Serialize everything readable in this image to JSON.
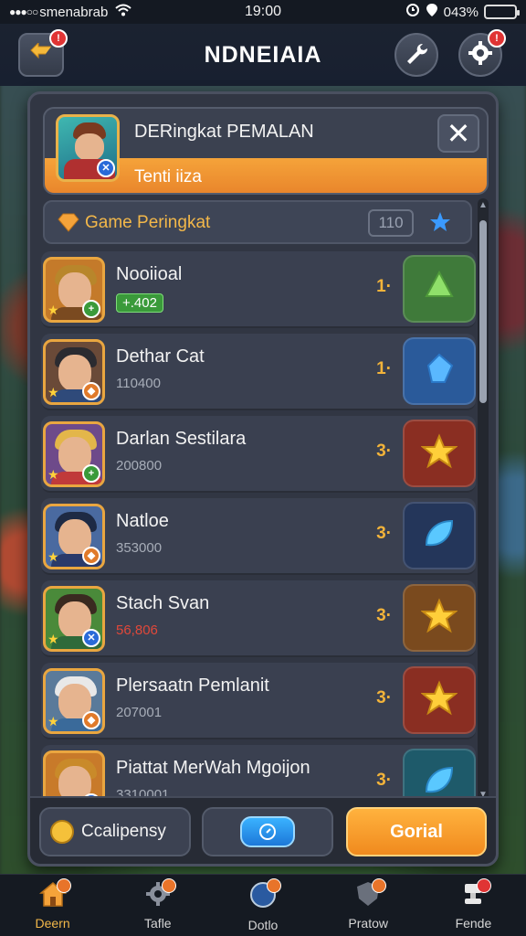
{
  "status_bar": {
    "carrier": "smenabrab",
    "time": "19:00",
    "battery": "043%",
    "battery_level": 0.43
  },
  "top_bar": {
    "title": "NDNEIAIA",
    "back_icon": "back-arrow-icon",
    "wrench_icon": "wrench-icon",
    "settings_icon": "gear-icon"
  },
  "panel": {
    "title": "DERingkat PEMALAN",
    "subtitle": "Tenti iiza",
    "close_label": "✕",
    "tab": {
      "label": "Game Peringkat",
      "count": "110"
    }
  },
  "players": [
    {
      "name": "Nooiioal",
      "score": "+.402",
      "score_style": "pill",
      "rank": "1·",
      "reward_color": "#3f7a3a",
      "reward_icon": "green-gem-icon",
      "hair": "#b8862b",
      "body": "#7a4a20",
      "bg": "#c47a2a",
      "badge": "+",
      "badge_color": "#3a9a3a"
    },
    {
      "name": "Dethar Cat",
      "score": "110400",
      "score_style": "normal",
      "rank": "1·",
      "reward_color": "#2a5a9a",
      "reward_icon": "blue-crystal-icon",
      "hair": "#2b2b30",
      "body": "#2f4a7a",
      "bg": "#6a4a38",
      "badge": "◆",
      "badge_color": "#e07a2a"
    },
    {
      "name": "Darlan Sestilara",
      "score": "200800",
      "score_style": "normal",
      "rank": "3·",
      "reward_color": "#8a2e22",
      "reward_icon": "gold-star-icon",
      "hair": "#e3b64a",
      "body": "#c03a3a",
      "bg": "#6e4a8a",
      "badge": "+",
      "badge_color": "#3a9a3a"
    },
    {
      "name": "Natloe",
      "score": "353000",
      "score_style": "normal",
      "rank": "3·",
      "reward_color": "#24365a",
      "reward_icon": "blue-leaf-icon",
      "hair": "#1e2a44",
      "body": "#2a3a6a",
      "bg": "#4a6aa0",
      "badge": "◆",
      "badge_color": "#e07a2a"
    },
    {
      "name": "Stach Svan",
      "score": "56,806",
      "score_style": "red",
      "rank": "3·",
      "reward_color": "#7a4a1e",
      "reward_icon": "gold-star-icon",
      "hair": "#3a2a20",
      "body": "#2f6a3a",
      "bg": "#4a8a3a",
      "badge": "✕",
      "badge_color": "#2a6ad8"
    },
    {
      "name": "Plersaatn Pemlanit",
      "score": "207001",
      "score_style": "normal",
      "rank": "3·",
      "reward_color": "#8a2e22",
      "reward_icon": "gold-star-icon",
      "hair": "#e8e8e8",
      "body": "#3a6a9a",
      "bg": "#5a7a9a",
      "badge": "◆",
      "badge_color": "#e07a2a"
    },
    {
      "name": "Piattat MerWah Mgoijon",
      "score": "3310001",
      "score_style": "normal",
      "rank": "3·",
      "reward_color": "#1e5a6a",
      "reward_icon": "blue-leaf-icon",
      "hair": "#c98a2a",
      "body": "#2f4a7a",
      "bg": "#c87a2a",
      "badge": "✕",
      "badge_color": "#2a6ad8"
    }
  ],
  "footer": {
    "left_label": "Ccalipensy",
    "right_label": "Gorial"
  },
  "bottom_nav": [
    {
      "label": "Deern",
      "icon": "home-icon",
      "active": true,
      "badge": "orange"
    },
    {
      "label": "Tafle",
      "icon": "gear-icon",
      "active": false,
      "badge": "orange"
    },
    {
      "label": "Dotlo",
      "icon": "compass-icon",
      "active": false,
      "badge": "orange"
    },
    {
      "label": "Pratow",
      "icon": "shield-icon",
      "active": false,
      "badge": "orange"
    },
    {
      "label": "Fende",
      "icon": "trophy-icon",
      "active": false,
      "badge": "red"
    }
  ]
}
